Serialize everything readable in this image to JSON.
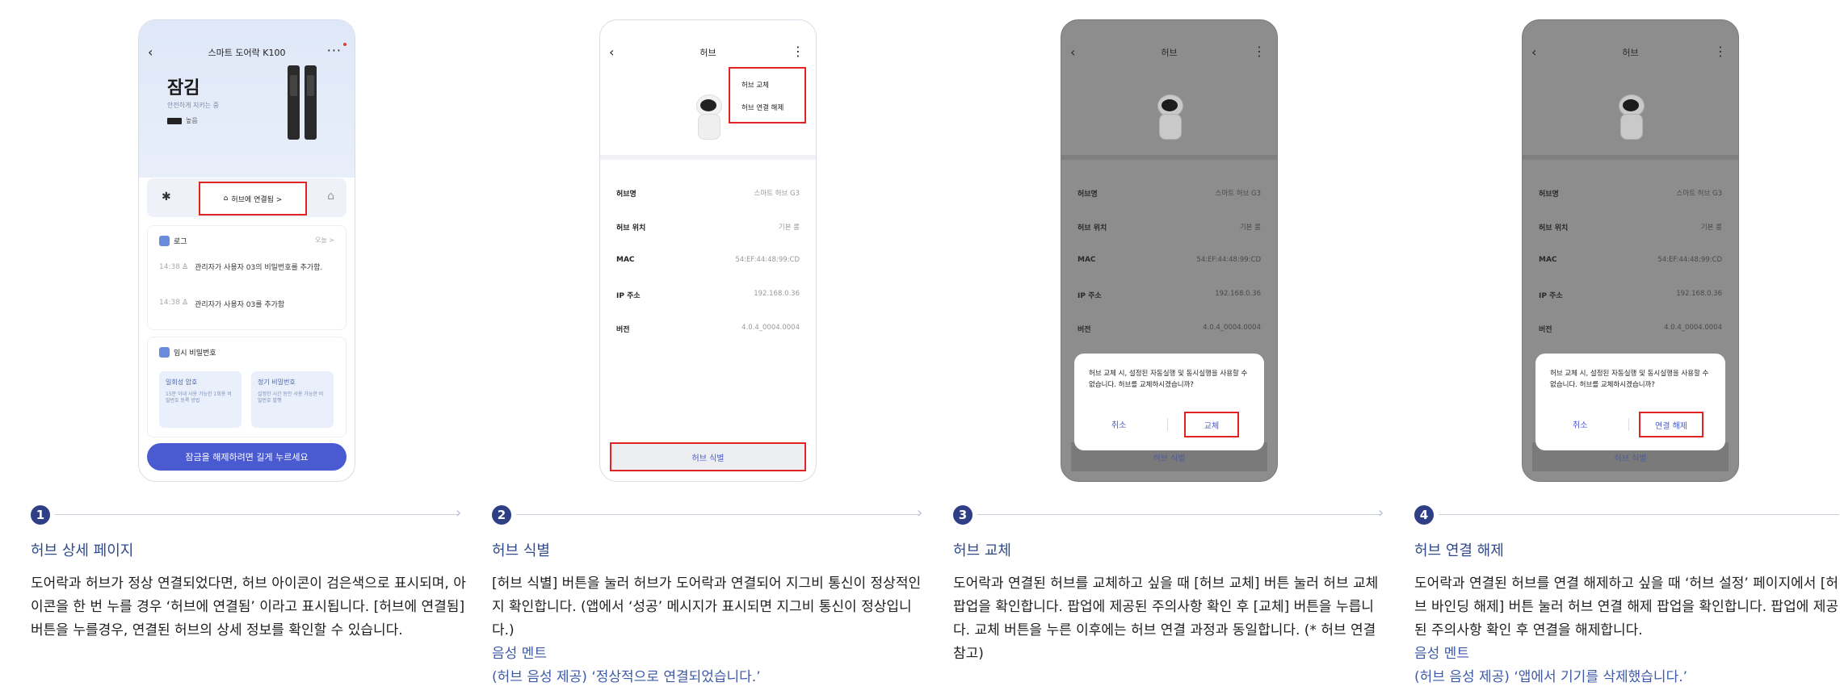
{
  "panels": [
    {
      "step": "1",
      "title": "허브 상세 페이지",
      "description": "도어락과 허브가 정상 연결되었다면, 허브 아이콘이 검은색으로 표시되며, 아이콘을 한 번 누를 경우 ‘허브에 연결됨’ 이라고 표시됩니다. [허브에 연결됨] 버튼을 누를경우, 연결된 허브의 상세 정보를 확인할 수 있습니다.",
      "screen": {
        "nav_title": "스마트 도어락 K100",
        "lock_state": "잠김",
        "lock_sub": "안전하게 지키는 중",
        "battery_label": "높음",
        "hub_connected_label": "허브에 연결됨 >",
        "log_title": "로그",
        "log_today": "오늘 >",
        "logs": [
          {
            "time": "14:38",
            "text": "관리자가 사용자 03의 비밀번호를 추가함."
          },
          {
            "time": "14:38",
            "text": "관리자가 사용자 03를 추가함"
          }
        ],
        "temp_pw_title": "임시 비밀번호",
        "pw_once_title": "일회성 암호",
        "pw_once_desc": "15분 이내 사용 가능한 1회용 비밀번호 등록 방법",
        "pw_regular_title": "정기 비밀번호",
        "pw_regular_desc": "설정한 시간 동안 사용 가능한 비밀번호 발행",
        "unlock_label": "잠금을 해제하려면 길게 누르세요"
      }
    },
    {
      "step": "2",
      "title": "허브 식별",
      "description": "[허브 식별] 버튼을 눌러 허브가 도어락과 연결되어 지그비 통신이 정상적인지 확인합니다. (앱에서 ‘성공’ 메시지가 표시되면 지그비 통신이 정상입니다.)",
      "voice_title": "음성 멘트",
      "voice_text": "(허브 음성 제공) ‘정상적으로 연결되었습니다.’",
      "screen": {
        "nav_title": "허브",
        "menu_items": [
          "허브 교체",
          "허브 연결 해제"
        ],
        "identify_label": "허브 식별"
      }
    },
    {
      "step": "3",
      "title": "허브 교체",
      "description": "도어락과 연결된 허브를 교체하고 싶을 때 [허브 교체] 버튼 눌러 허브 교체 팝업을 확인합니다. 팝업에 제공된 주의사항 확인 후 [교체] 버튼을 누릅니다. 교체 버튼을 누른 이후에는 허브 연결 과정과 동일합니다. (* 허브 연결 참고)",
      "screen": {
        "nav_title": "허브",
        "popup_message": "허브 교체 시, 설정된 자동실행 및 동시실행을 사용할 수 없습니다. 허브를 교체하시겠습니까?",
        "popup_cancel": "취소",
        "popup_confirm": "교체",
        "identify_label": "허브 식별"
      }
    },
    {
      "step": "4",
      "title": "허브 연결 해제",
      "description": "도어락과 연결된 허브를 연결 해제하고 싶을 때 ‘허브 설정’ 페이지에서 [허브 바인딩 해제] 버튼 눌러 허브 연결 해제 팝업을 확인합니다. 팝업에 제공된 주의사항 확인 후 연결을 해제합니다.",
      "voice_title": "음성 멘트",
      "voice_text": "(허브 음성 제공) ‘앱에서 기기를 삭제했습니다.’",
      "screen": {
        "nav_title": "허브",
        "popup_message": "허브 교체 시, 설정된 자동실행 및 동시실행을 사용할 수 없습니다. 허브를 교체하시겠습니까?",
        "popup_cancel": "취소",
        "popup_confirm": "연결 해제",
        "identify_label": "허브 식별"
      }
    }
  ],
  "hub_info": [
    {
      "key": "허브명",
      "value": "스마트 허브 G3"
    },
    {
      "key": "허브 위치",
      "value": "기본 룸"
    },
    {
      "key": "MAC",
      "value": "54:EF:44:48:99:CD"
    },
    {
      "key": "IP 주소",
      "value": "192.168.0.36"
    },
    {
      "key": "버전",
      "value": "4.0.4_0004.0004"
    }
  ],
  "colors": {
    "accent": "#2f3f86",
    "highlight": "#e02323",
    "button": "#4a5ad0"
  }
}
